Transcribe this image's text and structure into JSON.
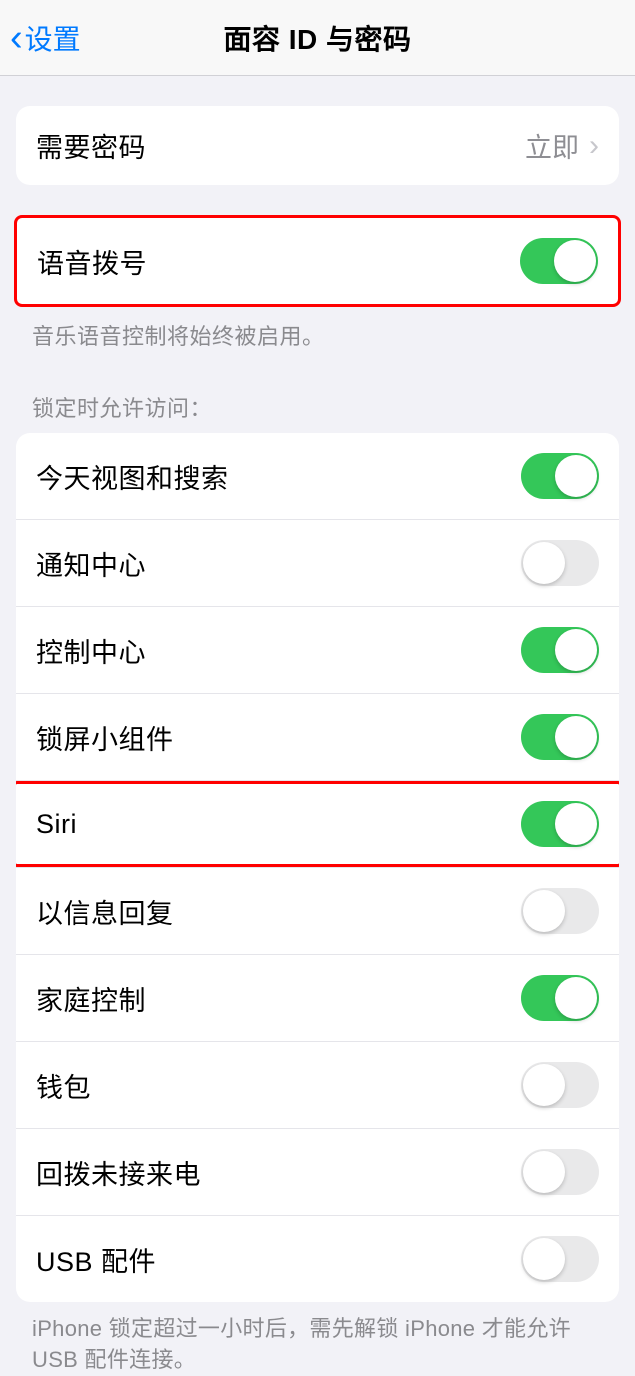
{
  "nav": {
    "back_label": "设置",
    "title": "面容 ID 与密码"
  },
  "require_passcode": {
    "label": "需要密码",
    "value": "立即"
  },
  "voice_dial": {
    "label": "语音拨号",
    "enabled": true,
    "footer": "音乐语音控制将始终被启用。"
  },
  "allow_access_header": "锁定时允许访问：",
  "allow_access_items": [
    {
      "label": "今天视图和搜索",
      "enabled": true
    },
    {
      "label": "通知中心",
      "enabled": false
    },
    {
      "label": "控制中心",
      "enabled": true
    },
    {
      "label": "锁屏小组件",
      "enabled": true
    },
    {
      "label": "Siri",
      "enabled": true,
      "highlighted": true
    },
    {
      "label": "以信息回复",
      "enabled": false
    },
    {
      "label": "家庭控制",
      "enabled": true
    },
    {
      "label": "钱包",
      "enabled": false
    },
    {
      "label": "回拨未接来电",
      "enabled": false
    },
    {
      "label": "USB 配件",
      "enabled": false
    }
  ],
  "footer_usb": "iPhone 锁定超过一小时后，需先解锁 iPhone 才能允许USB 配件连接。"
}
